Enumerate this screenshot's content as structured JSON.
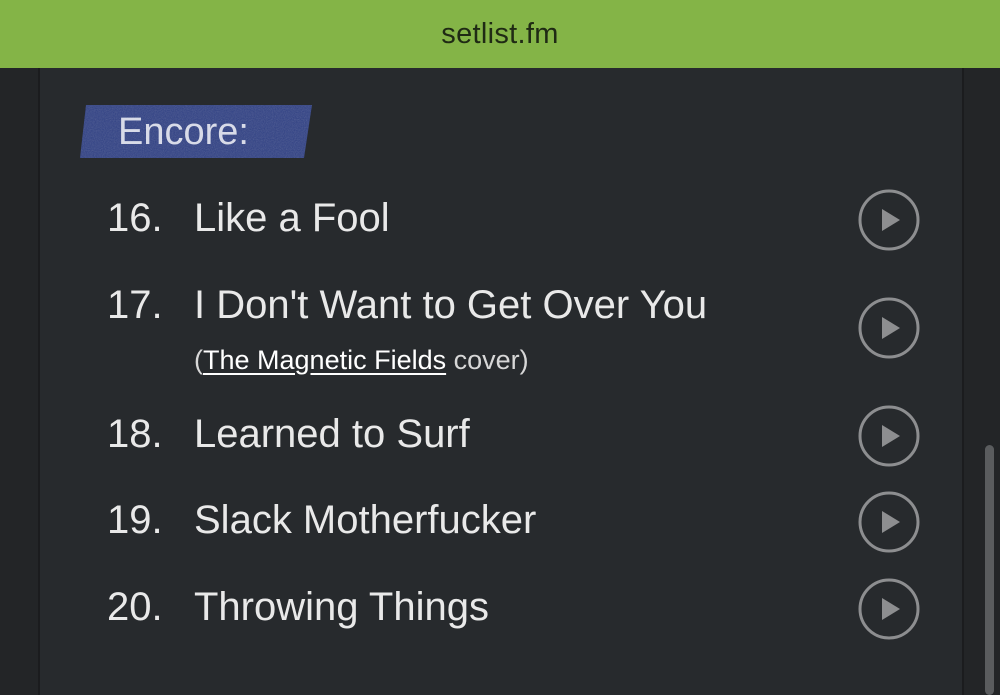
{
  "header": {
    "site_title": "setlist.fm",
    "bar_color": "#84b447"
  },
  "setlist": {
    "section_label": "Encore:",
    "section_tag_color": "#2e3f84",
    "songs": [
      {
        "number": "16.",
        "title": "Like a Fool",
        "play_icon": "play-circle-icon"
      },
      {
        "number": "17.",
        "title": "I Don't Want to Get Over You",
        "sub_open": "(",
        "cover_artist": "The Magnetic Fields",
        "sub_close": " cover)",
        "play_icon": "play-circle-icon"
      },
      {
        "number": "18.",
        "title": "Learned to Surf",
        "play_icon": "play-circle-icon"
      },
      {
        "number": "19.",
        "title": "Slack Motherfucker",
        "play_icon": "play-circle-icon"
      },
      {
        "number": "20.",
        "title": "Throwing Things",
        "play_icon": "play-circle-icon"
      }
    ]
  }
}
